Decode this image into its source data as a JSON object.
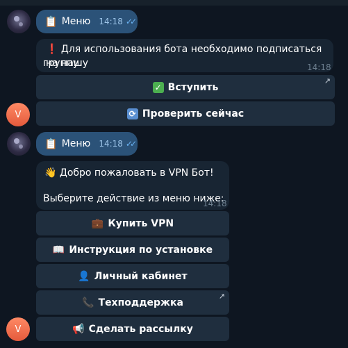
{
  "messages": [
    {
      "type": "outgoing",
      "icon": "clipboard-icon",
      "label": "Меню",
      "time": "14:18",
      "status": "read"
    },
    {
      "type": "incoming",
      "icon": "exclamation-icon",
      "text_line1": "Для использования бота необходимо подписаться на нашу",
      "text_line2": "группу.",
      "time": "14:18",
      "buttons": [
        {
          "icon": "check-icon",
          "label": "Вступить",
          "external": true
        },
        {
          "icon": "refresh-icon",
          "label": "Проверить сейчас",
          "external": false
        }
      ]
    },
    {
      "type": "outgoing",
      "icon": "clipboard-icon",
      "label": "Меню",
      "time": "14:18",
      "status": "read"
    },
    {
      "type": "incoming",
      "icon": "wave-icon",
      "text_line1": "Добро пожаловать в VPN Бот!",
      "text_line2": "Выберите действие из меню ниже:",
      "time": "14:18",
      "buttons": [
        {
          "icon": "briefcase-icon",
          "label": "Купить VPN",
          "external": false
        },
        {
          "icon": "book-icon",
          "label": "Инструкция по установке",
          "external": false
        },
        {
          "icon": "user-icon",
          "label": "Личный кабинет",
          "external": false
        },
        {
          "icon": "phone-icon",
          "label": "Техподдержка",
          "external": true
        },
        {
          "icon": "megaphone-icon",
          "label": "Сделать рассылку",
          "external": false
        }
      ]
    }
  ],
  "bot_avatar_letter": "V",
  "colors": {
    "background": "#0e1621",
    "outgoing_bubble": "#2b5278",
    "incoming_bubble": "#182533",
    "keyboard_button": "#1f2e3e",
    "read_ticks": "#6ab2f2",
    "bot_avatar": "#e45a3c"
  }
}
